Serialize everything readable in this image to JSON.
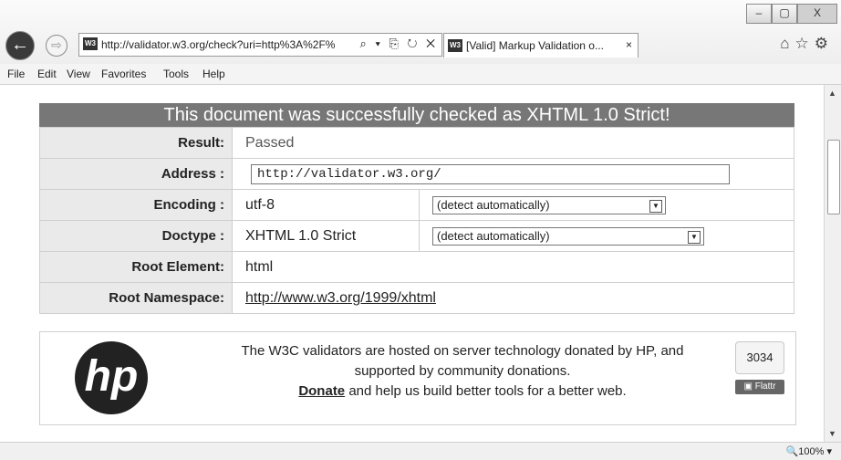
{
  "browser": {
    "window_controls": [
      "–",
      "▢",
      "X"
    ],
    "address_url": "http://validator.w3.org/check?uri=http%3A%2F%",
    "address_icons": "⌕ ▾ ⎘ ↻ ✕",
    "favicon": "W3",
    "tab_title": "[Valid] Markup Validation o...",
    "tab_close": "×",
    "right_icons": [
      "⌂",
      "☆",
      "⚙"
    ],
    "back": "←",
    "forward": "⇨",
    "zoom": "🔍100%  ▾"
  },
  "menu": [
    "File",
    "Edit",
    "View",
    "Favorites",
    "Tools",
    "Help"
  ],
  "page": {
    "banner": "This document was successfully checked as XHTML 1.0 Strict!",
    "rows": [
      {
        "label": "Result:",
        "value": "Passed"
      },
      {
        "label": "Address :",
        "value": "http://validator.w3.org/"
      },
      {
        "label": "Encoding :",
        "value": "utf-8",
        "select": "(detect automatically)"
      },
      {
        "label": "Doctype :",
        "value": "XHTML 1.0 Strict",
        "select": "(detect automatically)"
      },
      {
        "label": "Root Element:",
        "value": "html"
      },
      {
        "label": "Root Namespace:",
        "value": "http://www.w3.org/1999/xhtml"
      }
    ],
    "sponsor": {
      "logo": "hp",
      "line1": "The W3C validators are hosted on server technology donated by HP, and",
      "line2": "supported by community donations.",
      "donate": "Donate",
      "line3": " and help us build better tools for a better web.",
      "flattr_count": "3034",
      "flattr_label": "Flattr"
    }
  }
}
